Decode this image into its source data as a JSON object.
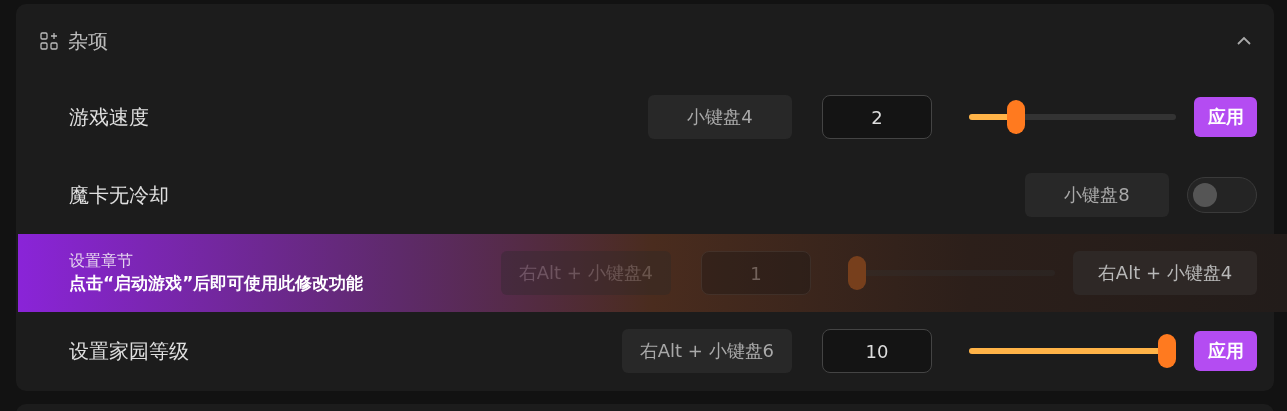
{
  "section": {
    "title": "杂项",
    "expanded": true
  },
  "rows": [
    {
      "kind": "slider",
      "label": "游戏速度",
      "disabled": false,
      "hotkey": "小键盘4",
      "value": "2",
      "level": 0.2,
      "action": {
        "kind": "apply",
        "label": "应用"
      }
    },
    {
      "kind": "toggle",
      "label": "魔卡无冷却",
      "disabled": false,
      "hotkey": "小键盘8",
      "on": false
    },
    {
      "kind": "slider",
      "label": "设置章节",
      "disabled": true,
      "notice": "点击“启动游戏”后即可使用此修改功能",
      "hotkey": "右Alt + 小键盘4",
      "value": "1",
      "level": 0,
      "action": {
        "kind": "hotkey",
        "label": "右Alt + 小键盘4"
      }
    },
    {
      "kind": "slider",
      "label": "设置家园等级",
      "disabled": false,
      "hotkey": "右Alt + 小键盘6",
      "value": "10",
      "level": 1,
      "action": {
        "kind": "apply",
        "label": "应用"
      }
    }
  ]
}
